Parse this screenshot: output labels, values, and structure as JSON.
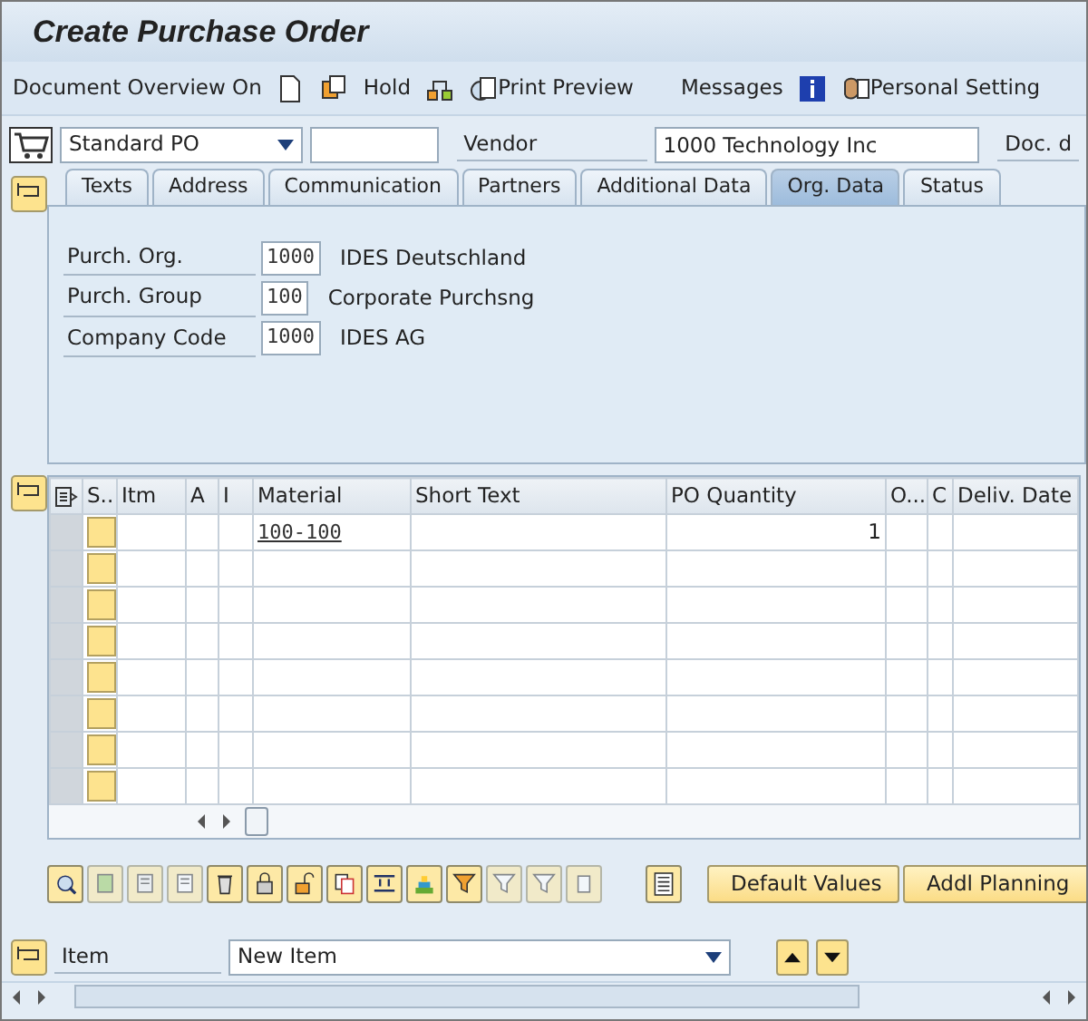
{
  "window": {
    "title": "Create Purchase Order"
  },
  "toolbar": [
    {
      "label": "Document Overview On"
    },
    {
      "label": "Hold"
    },
    {
      "label": "Print Preview"
    },
    {
      "label": "Messages"
    },
    {
      "label": "Personal Setting"
    }
  ],
  "header": {
    "doc_type": "Standard PO",
    "vendor_label": "Vendor",
    "vendor": "1000 Technology Inc",
    "doc_date_label": "Doc. d"
  },
  "tabs": [
    {
      "label": "Texts",
      "selected": false
    },
    {
      "label": "Address",
      "selected": false
    },
    {
      "label": "Communication",
      "selected": false
    },
    {
      "label": "Partners",
      "selected": false
    },
    {
      "label": "Additional Data",
      "selected": false
    },
    {
      "label": "Org. Data",
      "selected": true
    },
    {
      "label": "Status",
      "selected": false
    }
  ],
  "org_fields": [
    {
      "label": "Purch. Org.",
      "value": "1000",
      "description": "IDES Deutschland"
    },
    {
      "label": "Purch. Group",
      "value": "100",
      "description": "Corporate Purchsng"
    },
    {
      "label": "Company Code",
      "value": "1000",
      "description": "IDES AG"
    }
  ],
  "table": {
    "columns": [
      "S..",
      "Itm",
      "A",
      "I",
      "Material",
      "Short Text",
      "PO Quantity",
      "O...",
      "C",
      "Deliv. Date"
    ],
    "rows": [
      {
        "material": "100-100",
        "po_quantity": "1"
      },
      {},
      {},
      {},
      {},
      {},
      {},
      {}
    ]
  },
  "grid_tools": [
    {
      "disabled": false
    },
    {
      "disabled": true
    },
    {
      "disabled": true
    },
    {
      "disabled": true
    },
    {
      "disabled": false
    },
    {
      "disabled": false
    },
    {
      "disabled": false
    },
    {
      "disabled": false
    },
    {
      "disabled": false
    },
    {
      "disabled": false
    },
    {
      "disabled": false
    },
    {
      "disabled": true
    },
    {
      "disabled": true
    },
    {
      "disabled": true
    }
  ],
  "buttons": [
    "Default Values",
    "Addl Planning"
  ],
  "item_bar": {
    "label": "Item",
    "value": "New Item"
  }
}
